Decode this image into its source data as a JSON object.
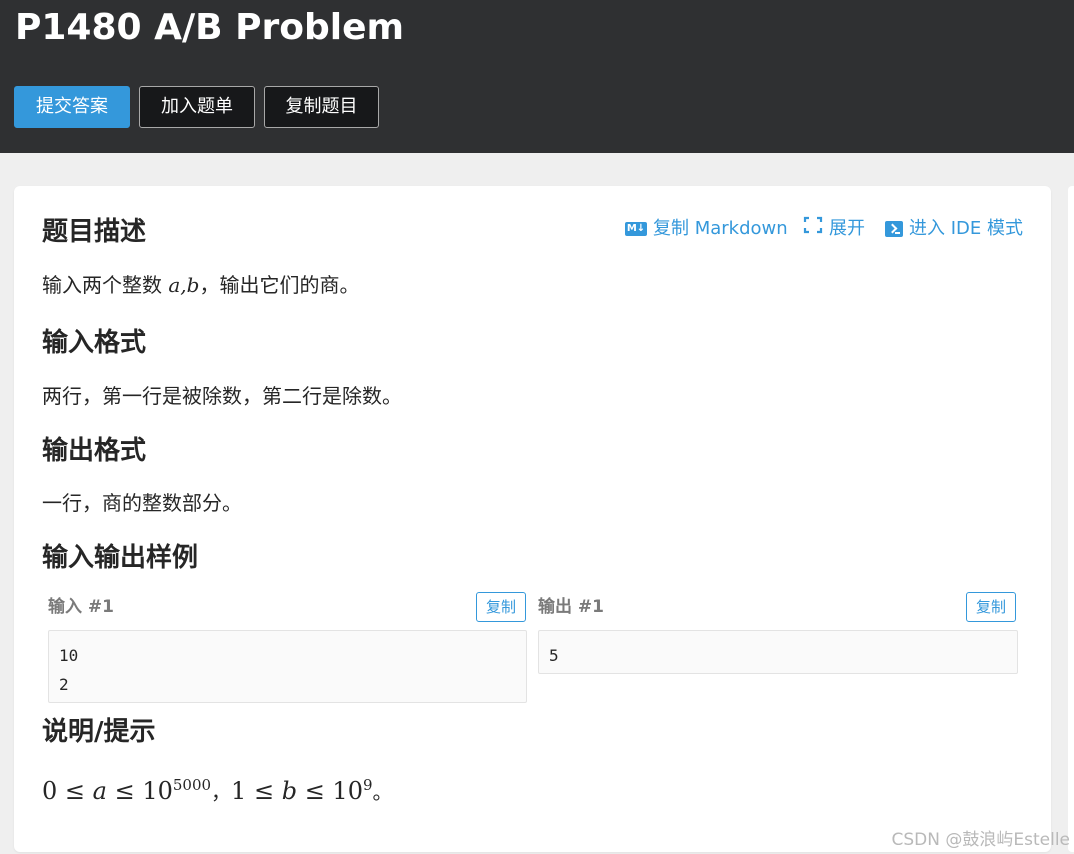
{
  "header": {
    "title": "P1480 A/B Problem",
    "buttons": {
      "submit": "提交答案",
      "add_list": "加入题单",
      "copy_problem": "复制题目"
    }
  },
  "toolbar": {
    "copy_markdown": "复制 Markdown",
    "expand": "展开",
    "ide_mode": "进入 IDE 模式",
    "md_icon_text": "M↓"
  },
  "sections": {
    "description": {
      "heading": "题目描述",
      "text_before": "输入两个整数 ",
      "math": "a,b",
      "text_after": "，输出它们的商。"
    },
    "input_format": {
      "heading": "输入格式",
      "text": "两行，第一行是被除数，第二行是除数。"
    },
    "output_format": {
      "heading": "输出格式",
      "text": "一行，商的整数部分。"
    },
    "samples": {
      "heading": "输入输出样例",
      "input_label": "输入 #1",
      "output_label": "输出 #1",
      "copy_label": "复制",
      "input_value": "10\n2",
      "output_value": "5"
    },
    "hint": {
      "heading": "说明/提示",
      "c1": "0 ≤ ",
      "v1": "a",
      "c2": " ≤ 10",
      "e1": "5000",
      "sep": "，",
      "c3": "1 ≤ ",
      "v2": "b",
      "c4": " ≤ 10",
      "e2": "9",
      "end": "。"
    }
  },
  "watermark": "CSDN @鼓浪屿Estelle",
  "colors": {
    "header_bg": "#2f3032",
    "accent": "#3498db",
    "page_bg": "#efefef"
  }
}
